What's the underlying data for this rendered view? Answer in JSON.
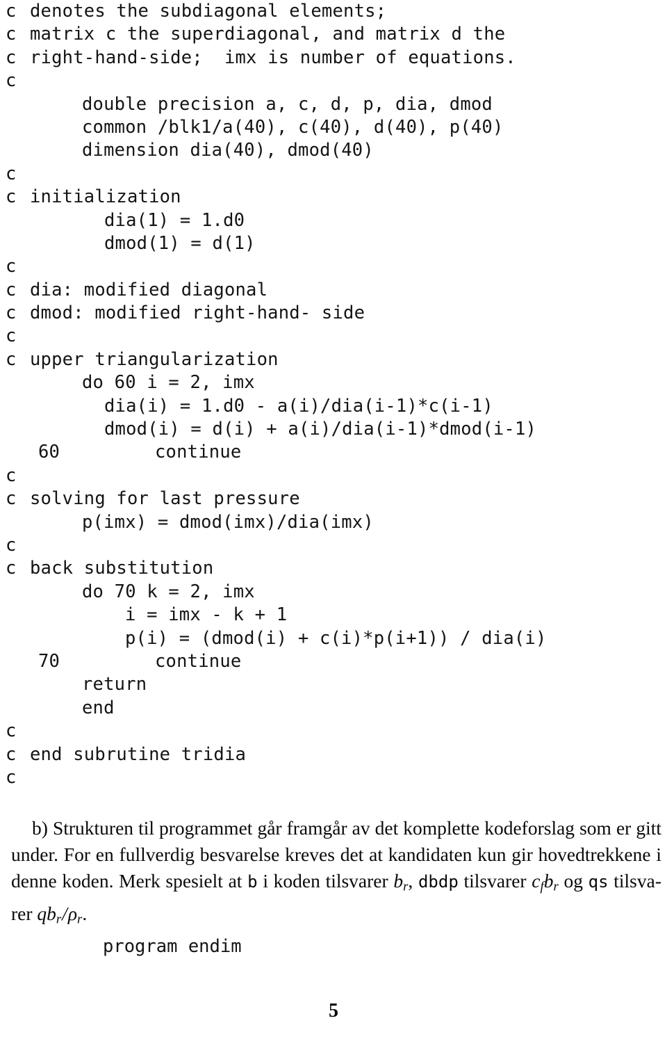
{
  "page": {
    "number": "5",
    "background_color": "#ffffff",
    "text_color": "#0d0d0d"
  },
  "code_listing": {
    "language": "fortran",
    "comment_marker": "c",
    "lines": [
      {
        "marker": "c",
        "indent": "comment",
        "text": "denotes the subdiagonal elements;"
      },
      {
        "marker": "c",
        "indent": "comment",
        "text": "matrix c the superdiagonal, and matrix d the"
      },
      {
        "marker": "c",
        "indent": "comment",
        "text": "right-hand-side;  imx is number of equations."
      },
      {
        "marker": "c",
        "indent": "comment",
        "text": ""
      },
      {
        "marker": "",
        "indent": "stmt",
        "text": "double precision a, c, d, p, dia, dmod"
      },
      {
        "marker": "",
        "indent": "stmt",
        "text": "common /blk1/a(40), c(40), d(40), p(40)"
      },
      {
        "marker": "",
        "indent": "stmt",
        "text": "dimension dia(40), dmod(40)"
      },
      {
        "marker": "c",
        "indent": "comment",
        "text": ""
      },
      {
        "marker": "c",
        "indent": "comment",
        "text": "initialization"
      },
      {
        "marker": "",
        "indent": "stmt2",
        "text": "dia(1) = 1.d0"
      },
      {
        "marker": "",
        "indent": "stmt2",
        "text": "dmod(1) = d(1)"
      },
      {
        "marker": "c",
        "indent": "comment",
        "text": ""
      },
      {
        "marker": "c",
        "indent": "comment",
        "text": "dia: modified diagonal"
      },
      {
        "marker": "c",
        "indent": "comment",
        "text": "dmod: modified right-hand- side"
      },
      {
        "marker": "c",
        "indent": "comment",
        "text": ""
      },
      {
        "marker": "c",
        "indent": "comment",
        "text": "upper triangularization"
      },
      {
        "marker": "",
        "indent": "stmt",
        "text": "do 60 i = 2, imx"
      },
      {
        "marker": "",
        "indent": "stmt2",
        "text": "dia(i) = 1.d0 - a(i)/dia(i-1)*c(i-1)"
      },
      {
        "marker": "",
        "indent": "stmt2",
        "text": "dmod(i) = d(i) + a(i)/dia(i-1)*dmod(i-1)"
      },
      {
        "marker": "60",
        "indent": "cont",
        "text": "continue"
      },
      {
        "marker": "c",
        "indent": "comment",
        "text": ""
      },
      {
        "marker": "c",
        "indent": "comment",
        "text": "solving for last pressure"
      },
      {
        "marker": "",
        "indent": "stmt",
        "text": "p(imx) = dmod(imx)/dia(imx)"
      },
      {
        "marker": "c",
        "indent": "comment",
        "text": ""
      },
      {
        "marker": "c",
        "indent": "comment",
        "text": "back substitution"
      },
      {
        "marker": "",
        "indent": "stmt",
        "text": "do 70 k = 2, imx"
      },
      {
        "marker": "",
        "indent": "stmt3",
        "text": "i = imx - k + 1"
      },
      {
        "marker": "",
        "indent": "stmt3",
        "text": "p(i) = (dmod(i) + c(i)*p(i+1)) / dia(i)"
      },
      {
        "marker": "70",
        "indent": "cont",
        "text": "continue"
      },
      {
        "marker": "",
        "indent": "stmt",
        "text": "return"
      },
      {
        "marker": "",
        "indent": "stmt",
        "text": "end"
      },
      {
        "marker": "c",
        "indent": "comment",
        "text": ""
      },
      {
        "marker": "c",
        "indent": "comment",
        "text": "end subrutine tridia"
      },
      {
        "marker": "c",
        "indent": "comment",
        "text": ""
      }
    ]
  },
  "answer_paragraph": {
    "label": "b)",
    "line1": "Strukturen til programmet går framgår av det komplette kodeforslag som er gitt",
    "line2": "under. For en fullverdig besvarelse kreves det at kandidaten kun gir hovedtrekkene i",
    "line3_a": "denne koden. Merk spesielt at",
    "code_b": "b",
    "line3_b": "i koden tilsvarer",
    "math_br": "b",
    "math_br_sub": "r",
    "line3_c": ",",
    "code_dbdp": "dbdp",
    "line3_d": "tilsvarer",
    "math_c": "c",
    "math_c_sub": "f",
    "math_b2": "b",
    "math_b2_sub": "r",
    "line3_e": "og",
    "code_qs": "qs",
    "line3_f": "tilsva-",
    "line4_a": "rer",
    "math_q": "q",
    "math_b3": "b",
    "math_b3_sub": "r",
    "math_slash": "/",
    "math_rho": "ρ",
    "math_rho_sub": "r",
    "line4_b": "."
  },
  "trailing_code": {
    "text": "program endim"
  }
}
